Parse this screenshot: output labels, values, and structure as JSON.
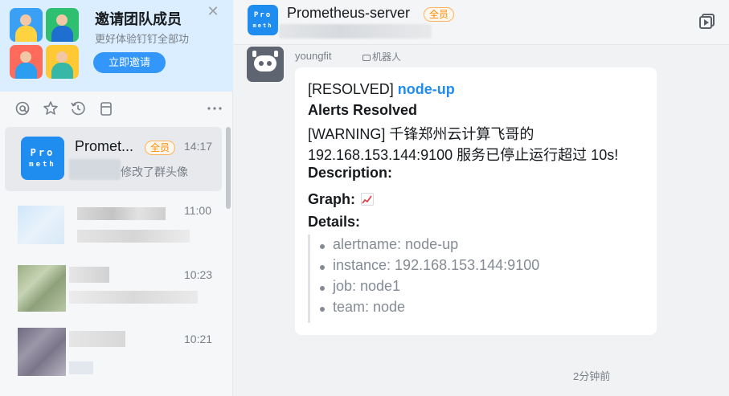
{
  "invite": {
    "title": "邀请团队成员",
    "subtitle": "更好体验钉钉全部功",
    "button_label": "立即邀请",
    "close_glyph": "✕"
  },
  "toolbar": {
    "icons": [
      "at-icon",
      "star-icon",
      "history-icon",
      "clipboard-icon",
      "more-icon"
    ]
  },
  "conversations": [
    {
      "name": "Promet...",
      "badge": "全员",
      "time": "14:17",
      "preview": "修改了群头像",
      "avatar_text": [
        "Pro",
        "meth"
      ]
    },
    {
      "time": "11:00"
    },
    {
      "time": "10:23"
    },
    {
      "time": "10:21"
    }
  ],
  "chat": {
    "title": "Prometheus-server",
    "badge": "全员",
    "avatar_text": [
      "Pro",
      "meth"
    ],
    "sender": "youngfit",
    "robot_label": "机器人",
    "message": {
      "status_prefix": "[RESOLVED]",
      "alert_name": "node-up",
      "heading": "Alerts Resolved",
      "warning_line1": "[WARNING] 千锋郑州云计算飞哥的",
      "warning_line2": "192.168.153.144:9100 服务已停止运行超过 10s!",
      "description_label": "Description:",
      "graph_label": "Graph:",
      "details_label": "Details:",
      "details": [
        "alertname: node-up",
        "instance: 192.168.153.144:9100",
        "job: node1",
        "team: node"
      ]
    },
    "time_ago": "2分钟前"
  },
  "colors": {
    "accent": "#1f8cf0",
    "invite_bg": "#dbeeff",
    "badge_orange": "#ff8a00"
  }
}
